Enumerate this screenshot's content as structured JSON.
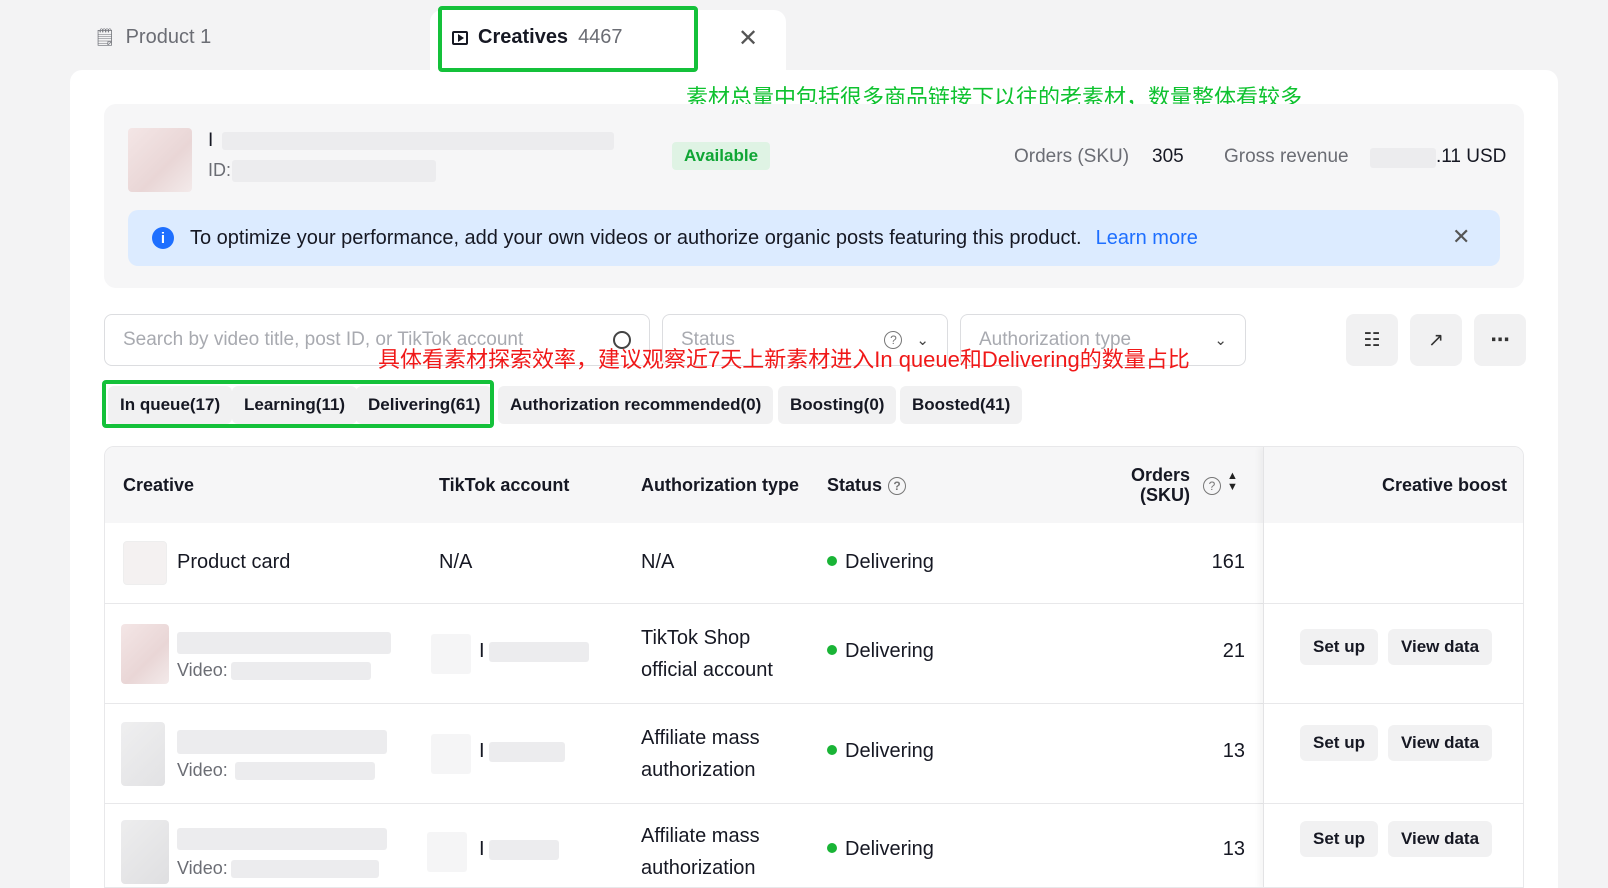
{
  "tabs": {
    "product_label": "Product 1",
    "creatives_label": "Creatives",
    "creatives_count": "4467"
  },
  "annotations": {
    "green_note": "素材总量中包括很多商品链接下以往的老素材，数量整体看较多",
    "red_note": "具体看素材探索效率，建议观察近7天上新素材进入In queue和Delivering的数量占比"
  },
  "product": {
    "name_visible": "I",
    "id_label": "ID:",
    "badge": "Available",
    "orders_label": "Orders (SKU)",
    "orders_value": "305",
    "revenue_label": "Gross revenue",
    "revenue_value": ".11 USD"
  },
  "info_bar": {
    "text": "To optimize your performance, add your own videos or authorize organic posts featuring this product.",
    "link": "Learn more"
  },
  "filters": {
    "search_placeholder": "Search by video title, post ID, or TikTok account",
    "status_placeholder": "Status",
    "auth_placeholder": "Authorization type"
  },
  "status_tabs": [
    "In queue(17)",
    "Learning(11)",
    "Delivering(61)",
    "Authorization recommended(0)",
    "Boosting(0)",
    "Boosted(41)"
  ],
  "table": {
    "headers": {
      "creative": "Creative",
      "tiktok_account": "TikTok account",
      "authorization_type": "Authorization type",
      "status": "Status",
      "orders_line1": "Orders",
      "orders_line2": "(SKU)",
      "creative_boost": "Creative boost"
    },
    "rows": [
      {
        "creative": "Product card",
        "account": "N/A",
        "auth_line1": "N/A",
        "auth_line2": "",
        "status": "Delivering",
        "orders": "161"
      },
      {
        "creative": "",
        "video_label": "Video:",
        "account": "I",
        "auth_line1": "TikTok Shop",
        "auth_line2": "official account",
        "status": "Delivering",
        "orders": "21"
      },
      {
        "creative": "",
        "video_label": "Video:",
        "account": "I",
        "auth_line1": "Affiliate mass",
        "auth_line2": "authorization",
        "status": "Delivering",
        "orders": "13"
      },
      {
        "creative": "",
        "video_label": "Video:",
        "account": "I",
        "auth_line1": "Affiliate mass",
        "auth_line2": "authorization",
        "status": "Delivering",
        "orders": "13"
      }
    ],
    "action_setup": "Set up",
    "action_view": "View data"
  },
  "colors": {
    "highlight_green": "#14c13a",
    "note_red": "#f01818",
    "link_blue": "#1e6fff",
    "delivering_dot": "#19b436"
  }
}
